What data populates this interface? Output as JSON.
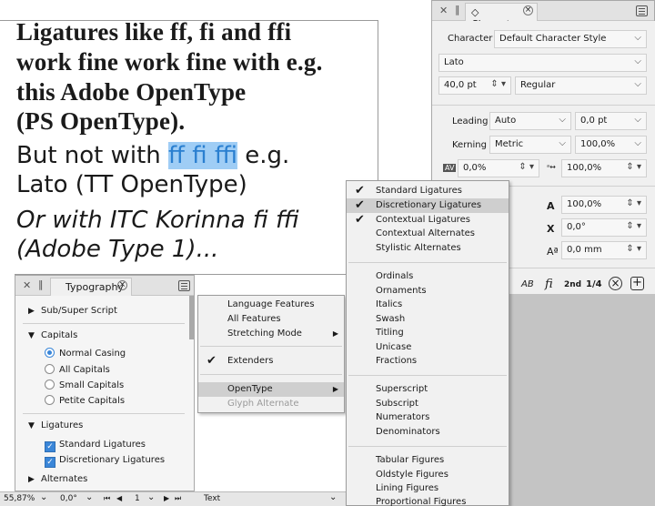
{
  "document": {
    "line1": "Ligatures like ff, fi and ffi",
    "line2": "work fine work fine with e.g.",
    "line3": "this Adobe OpenType",
    "line4": "(PS OpenType).",
    "line5_pre": "But not with ",
    "line5_highlight": "ff fi ffi",
    "line5_post": " e.g.",
    "line6": "Lato (TT OpenType)",
    "line7": "Or with ITC Korinna fi ffi",
    "line8": "(Adobe Type 1)..."
  },
  "character_panel": {
    "tab_label": "Character",
    "tab_chevron": "◇",
    "character_style_label": "Character",
    "character_style_value": "Default Character Style",
    "font_family": "Lato",
    "font_size": "40,0 pt",
    "font_style": "Regular",
    "leading_label": "Leading",
    "leading_mode": "Auto",
    "leading_value": "0,0 pt",
    "kerning_label": "Kerning",
    "kerning_mode": "Metric",
    "kerning_value": "100,0%",
    "tracking_value": "0,0%",
    "scale_value": "100,0%",
    "row5_value": "100,0%",
    "row6_value": "0,0°",
    "row7_value": "0,0 mm",
    "typo_buttons": [
      "AB",
      "fi",
      "2nd",
      "1/4"
    ]
  },
  "typography_panel": {
    "tab_label": "Typography",
    "sub_super": "Sub/Super Script",
    "capitals": "Capitals",
    "casing_options": [
      "Normal Casing",
      "All Capitals",
      "Small Capitals",
      "Petite Capitals"
    ],
    "ligatures": "Ligatures",
    "ligature_options": [
      "Standard Ligatures",
      "Discretionary Ligatures"
    ],
    "alternates": "Alternates"
  },
  "status_bar": {
    "zoom": "55,87%",
    "angle": "0,0°",
    "page": "1",
    "mode": "Text"
  },
  "context_menu": {
    "items": [
      "Language Features",
      "All Features",
      "Stretching Mode",
      "Extenders",
      "OpenType",
      "Glyph Alternate"
    ]
  },
  "opentype_submenu": {
    "group1": [
      "Standard Ligatures",
      "Discretionary Ligatures",
      "Contextual Ligatures",
      "Contextual Alternates",
      "Stylistic Alternates"
    ],
    "group2": [
      "Ordinals",
      "Ornaments",
      "Italics",
      "Swash",
      "Titling",
      "Unicase",
      "Fractions"
    ],
    "group3": [
      "Superscript",
      "Subscript",
      "Numerators",
      "Denominators"
    ],
    "group4": [
      "Tabular Figures",
      "Oldstyle Figures",
      "Lining Figures",
      "Proportional Figures"
    ]
  },
  "colors": {
    "highlight": "#9fcdf5",
    "accent": "#3a86d8",
    "menu_selected": "#cfcfcf"
  }
}
